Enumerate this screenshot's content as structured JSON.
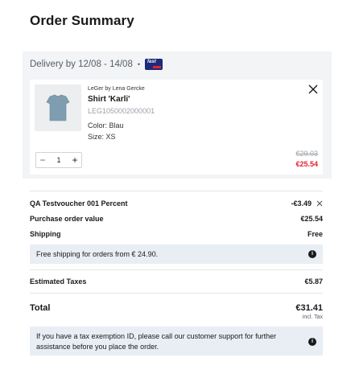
{
  "page": {
    "title": "Order Summary"
  },
  "delivery": {
    "label": "Delivery by 12/08 - 14/08",
    "separator": "•",
    "badge_text": "fast"
  },
  "item": {
    "brand": "LeGer by Lena Gercke",
    "name": "Shirt 'Karli'",
    "sku": "LEG1050002000001",
    "color": "Color: Blau",
    "size": "Size: XS",
    "quantity": "1",
    "minus": "−",
    "plus": "+",
    "old_price": "€29.03",
    "new_price": "€25.54"
  },
  "summary": {
    "voucher_label": "QA Testvoucher 001 Percent",
    "voucher_value": "-€3.49",
    "purchase_label": "Purchase order value",
    "purchase_value": "€25.54",
    "shipping_label": "Shipping",
    "shipping_value": "Free",
    "free_shipping_note": "Free shipping for orders from € 24.90.",
    "taxes_label": "Estimated Taxes",
    "taxes_value": "€5.87",
    "total_label": "Total",
    "total_value": "€31.41",
    "incl_tax": "incl. Tax",
    "tax_note": "If you have a tax exemption ID, please call our customer support for further assistance before you place the order."
  },
  "icons": {
    "info": "info-icon",
    "close": "close-icon",
    "remove_voucher": "close-icon"
  },
  "colors": {
    "sale_red": "#e3222f",
    "info_bg": "#e8eef4",
    "band_bg": "#f2f4f6",
    "badge_blue": "#1e2a78"
  }
}
